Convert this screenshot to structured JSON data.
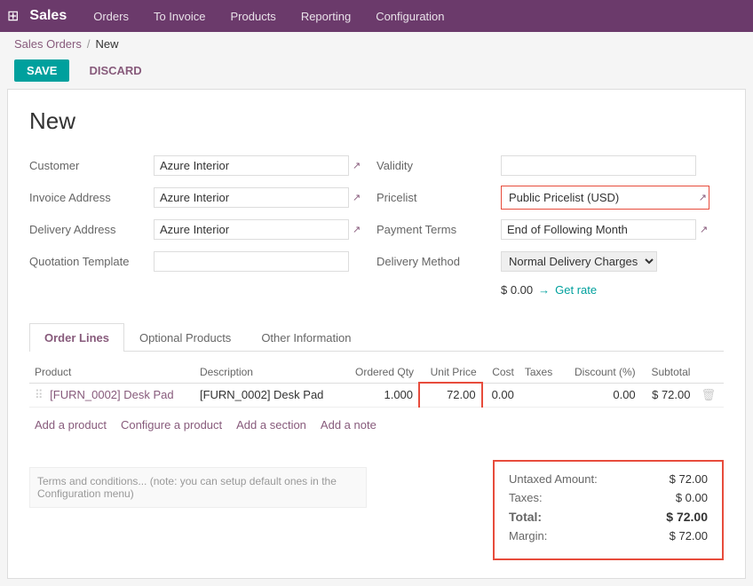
{
  "topbar": {
    "app_icon": "⊞",
    "app_title": "Sales",
    "nav_items": [
      "Orders",
      "To Invoice",
      "Products",
      "Reporting",
      "Configuration"
    ]
  },
  "breadcrumb": {
    "parent": "Sales Orders",
    "separator": "/",
    "current": "New"
  },
  "actions": {
    "save": "SAVE",
    "discard": "DISCARD"
  },
  "form": {
    "title": "New",
    "left_fields": [
      {
        "label": "Customer",
        "value": "Azure Interior",
        "type": "select"
      },
      {
        "label": "Invoice Address",
        "value": "Azure Interior",
        "type": "select"
      },
      {
        "label": "Delivery Address",
        "value": "Azure Interior",
        "type": "select"
      },
      {
        "label": "Quotation Template",
        "value": "",
        "type": "select"
      }
    ],
    "right_fields": [
      {
        "label": "Validity",
        "value": "",
        "type": "select"
      },
      {
        "label": "Pricelist",
        "value": "Public Pricelist (USD)",
        "type": "select",
        "highlight": true,
        "external_link": true
      },
      {
        "label": "Payment Terms",
        "value": "End of Following Month",
        "type": "select",
        "external_link": true
      },
      {
        "label": "Delivery Method",
        "value": "Normal Delivery Charges",
        "type": "select"
      }
    ],
    "delivery_amount": "$ 0.00",
    "get_rate": "→ Get rate"
  },
  "tabs": [
    {
      "id": "order-lines",
      "label": "Order Lines",
      "active": true
    },
    {
      "id": "optional-products",
      "label": "Optional Products",
      "active": false
    },
    {
      "id": "other-information",
      "label": "Other Information",
      "active": false
    }
  ],
  "table": {
    "columns": [
      {
        "key": "product",
        "label": "Product"
      },
      {
        "key": "description",
        "label": "Description"
      },
      {
        "key": "ordered_qty",
        "label": "Ordered Qty"
      },
      {
        "key": "unit_price",
        "label": "Unit Price",
        "highlight": true
      },
      {
        "key": "cost",
        "label": "Cost"
      },
      {
        "key": "taxes",
        "label": "Taxes"
      },
      {
        "key": "discount",
        "label": "Discount (%)"
      },
      {
        "key": "subtotal",
        "label": "Subtotal"
      }
    ],
    "rows": [
      {
        "product": "[FURN_0002] Desk Pad",
        "description": "[FURN_0002] Desk Pad",
        "ordered_qty": "1.000",
        "unit_price": "72.00",
        "cost": "0.00",
        "taxes": "",
        "discount": "0.00",
        "subtotal": "$ 72.00"
      }
    ],
    "actions": [
      {
        "key": "add-product",
        "label": "Add a product"
      },
      {
        "key": "configure-product",
        "label": "Configure a product"
      },
      {
        "key": "add-section",
        "label": "Add a section"
      },
      {
        "key": "add-note",
        "label": "Add a note"
      }
    ]
  },
  "terms": {
    "text": "Terms and conditions... (note: you can setup default ones in the Configuration menu)"
  },
  "totals": {
    "untaxed_amount_label": "Untaxed Amount:",
    "untaxed_amount_value": "$ 72.00",
    "taxes_label": "Taxes:",
    "taxes_value": "$ 0.00",
    "total_label": "Total:",
    "total_value": "$ 72.00",
    "margin_label": "Margin:",
    "margin_value": "$ 72.00"
  }
}
